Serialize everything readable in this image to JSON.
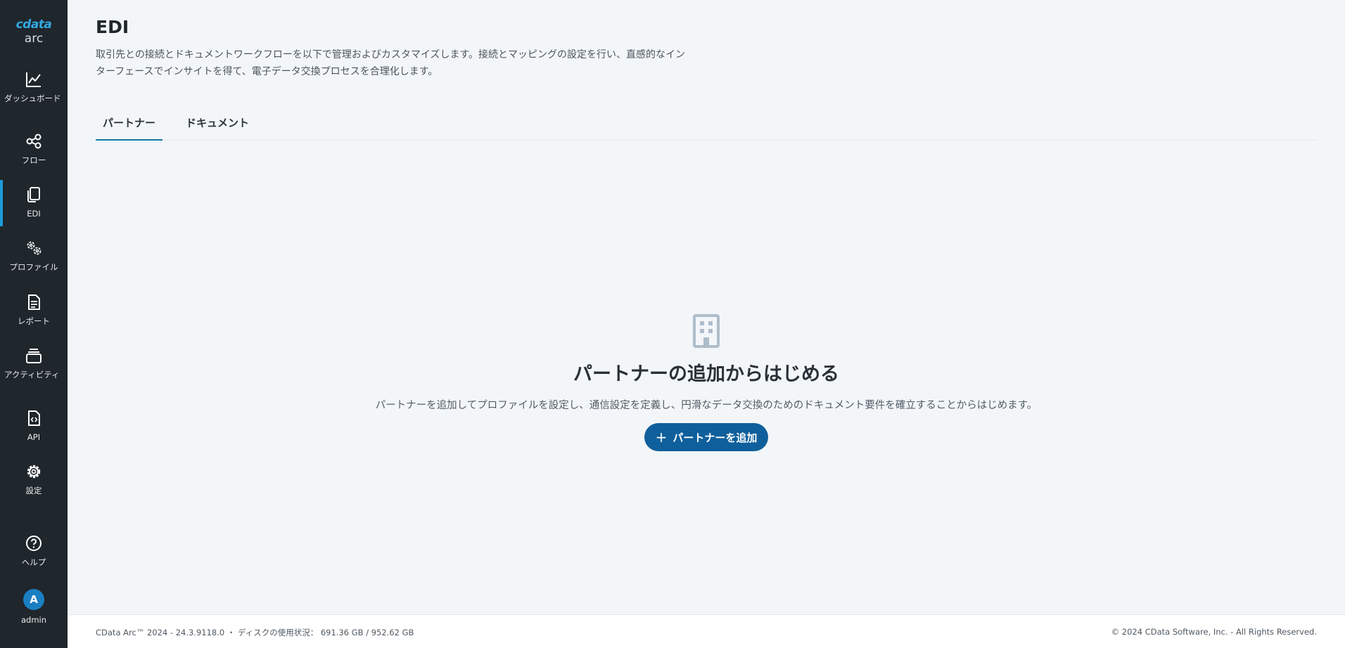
{
  "sidebar": {
    "logo": {
      "brand": "cdata",
      "product": "arc"
    },
    "items": [
      {
        "label": "ダッシュボード",
        "icon": "chart-line-icon"
      },
      {
        "label": "フロー",
        "icon": "share-nodes-icon"
      },
      {
        "label": "EDI",
        "icon": "copy-documents-icon",
        "active": true
      },
      {
        "label": "プロファイル",
        "icon": "gears-icon"
      },
      {
        "label": "レポート",
        "icon": "report-document-icon"
      },
      {
        "label": "アクティビティ",
        "icon": "stacked-cards-icon"
      },
      {
        "label": "API",
        "icon": "code-file-icon"
      },
      {
        "label": "設定",
        "icon": "gear-icon"
      }
    ],
    "help": {
      "label": "ヘルプ",
      "icon": "question-circle-icon"
    },
    "user": {
      "initial": "A",
      "name": "admin"
    }
  },
  "page": {
    "title": "EDI",
    "description": "取引先との接続とドキュメントワークフローを以下で管理およびカスタマイズします。接続とマッピングの設定を行い、直感的なインターフェースでインサイトを得て、電子データ交換プロセスを合理化します。"
  },
  "tabs": [
    {
      "label": "パートナー",
      "active": true
    },
    {
      "label": "ドキュメント",
      "active": false
    }
  ],
  "empty_state": {
    "icon": "building-icon",
    "title": "パートナーの追加からはじめる",
    "description": "パートナーを追加してプロファイルを設定し、通信設定を定義し、円滑なデータ交換のためのドキュメント要件を確立することからはじめます。",
    "button_label": "パートナーを追加",
    "button_icon": "plus-icon"
  },
  "footer": {
    "version": "CData Arc™ 2024 - 24.3.9118.0 ・ ディスクの使用状況： 691.36 GB / 952.62 GB",
    "copyright": "© 2024 CData Software, Inc. - All Rights Reserved."
  },
  "colors": {
    "sidebar_bg": "#1f262c",
    "accent": "#1d9bd7",
    "primary_button": "#0f5f9c",
    "page_bg": "#f3f6f9"
  }
}
